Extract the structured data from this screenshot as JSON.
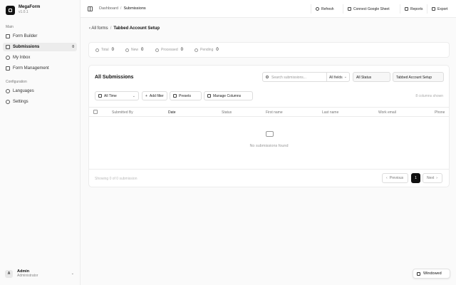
{
  "sidebar": {
    "brand_name": "MegaForm",
    "brand_version": "v1.0.1",
    "main_label": "Main",
    "main_items": [
      {
        "label": "Form Builder",
        "icon": "form-icon"
      },
      {
        "label": "Submissions",
        "icon": "inbox-icon",
        "badge": "0",
        "active": true
      },
      {
        "label": "My Inbox",
        "icon": "mail-icon"
      },
      {
        "label": "Form Management",
        "icon": "folder-icon"
      }
    ],
    "config_label": "Configuration",
    "config_items": [
      {
        "label": "Languages",
        "icon": "globe-icon"
      },
      {
        "label": "Settings",
        "icon": "gear-icon"
      }
    ],
    "user": {
      "initial": "A",
      "name": "Admin",
      "role": "Administrator"
    }
  },
  "topbar": {
    "crumbs": [
      "Dashboard",
      "Submissions"
    ],
    "buttons": [
      "Refresh",
      "Connect Google Sheet",
      "Reports",
      "Export"
    ]
  },
  "page": {
    "back_label": "All forms",
    "form_title": "Tabbed Account Setup"
  },
  "stats": [
    {
      "label": "Total",
      "value": "0"
    },
    {
      "label": "New",
      "value": "0"
    },
    {
      "label": "Processed",
      "value": "0"
    },
    {
      "label": "Pending",
      "value": "0"
    }
  ],
  "submissions": {
    "title": "All Submissions",
    "search_placeholder": "Search submissions...",
    "search_field": "All fields",
    "status_select": "All Status",
    "form_select": "Tabbed Account Setup",
    "time_filter": "All Time",
    "add_filter": "Add filter",
    "presets": "Presets",
    "manage_columns": "Manage Columns",
    "columns_shown": "8 columns shown",
    "columns": [
      "Submitted By",
      "Date",
      "Status",
      "First name",
      "Last name",
      "Work email",
      "Phone"
    ],
    "empty_text": "No submissions found",
    "showing": "Showing 0 of 0 submission",
    "prev": "Previous",
    "page": "1",
    "next": "Next"
  },
  "windowed_label": "Windowed"
}
